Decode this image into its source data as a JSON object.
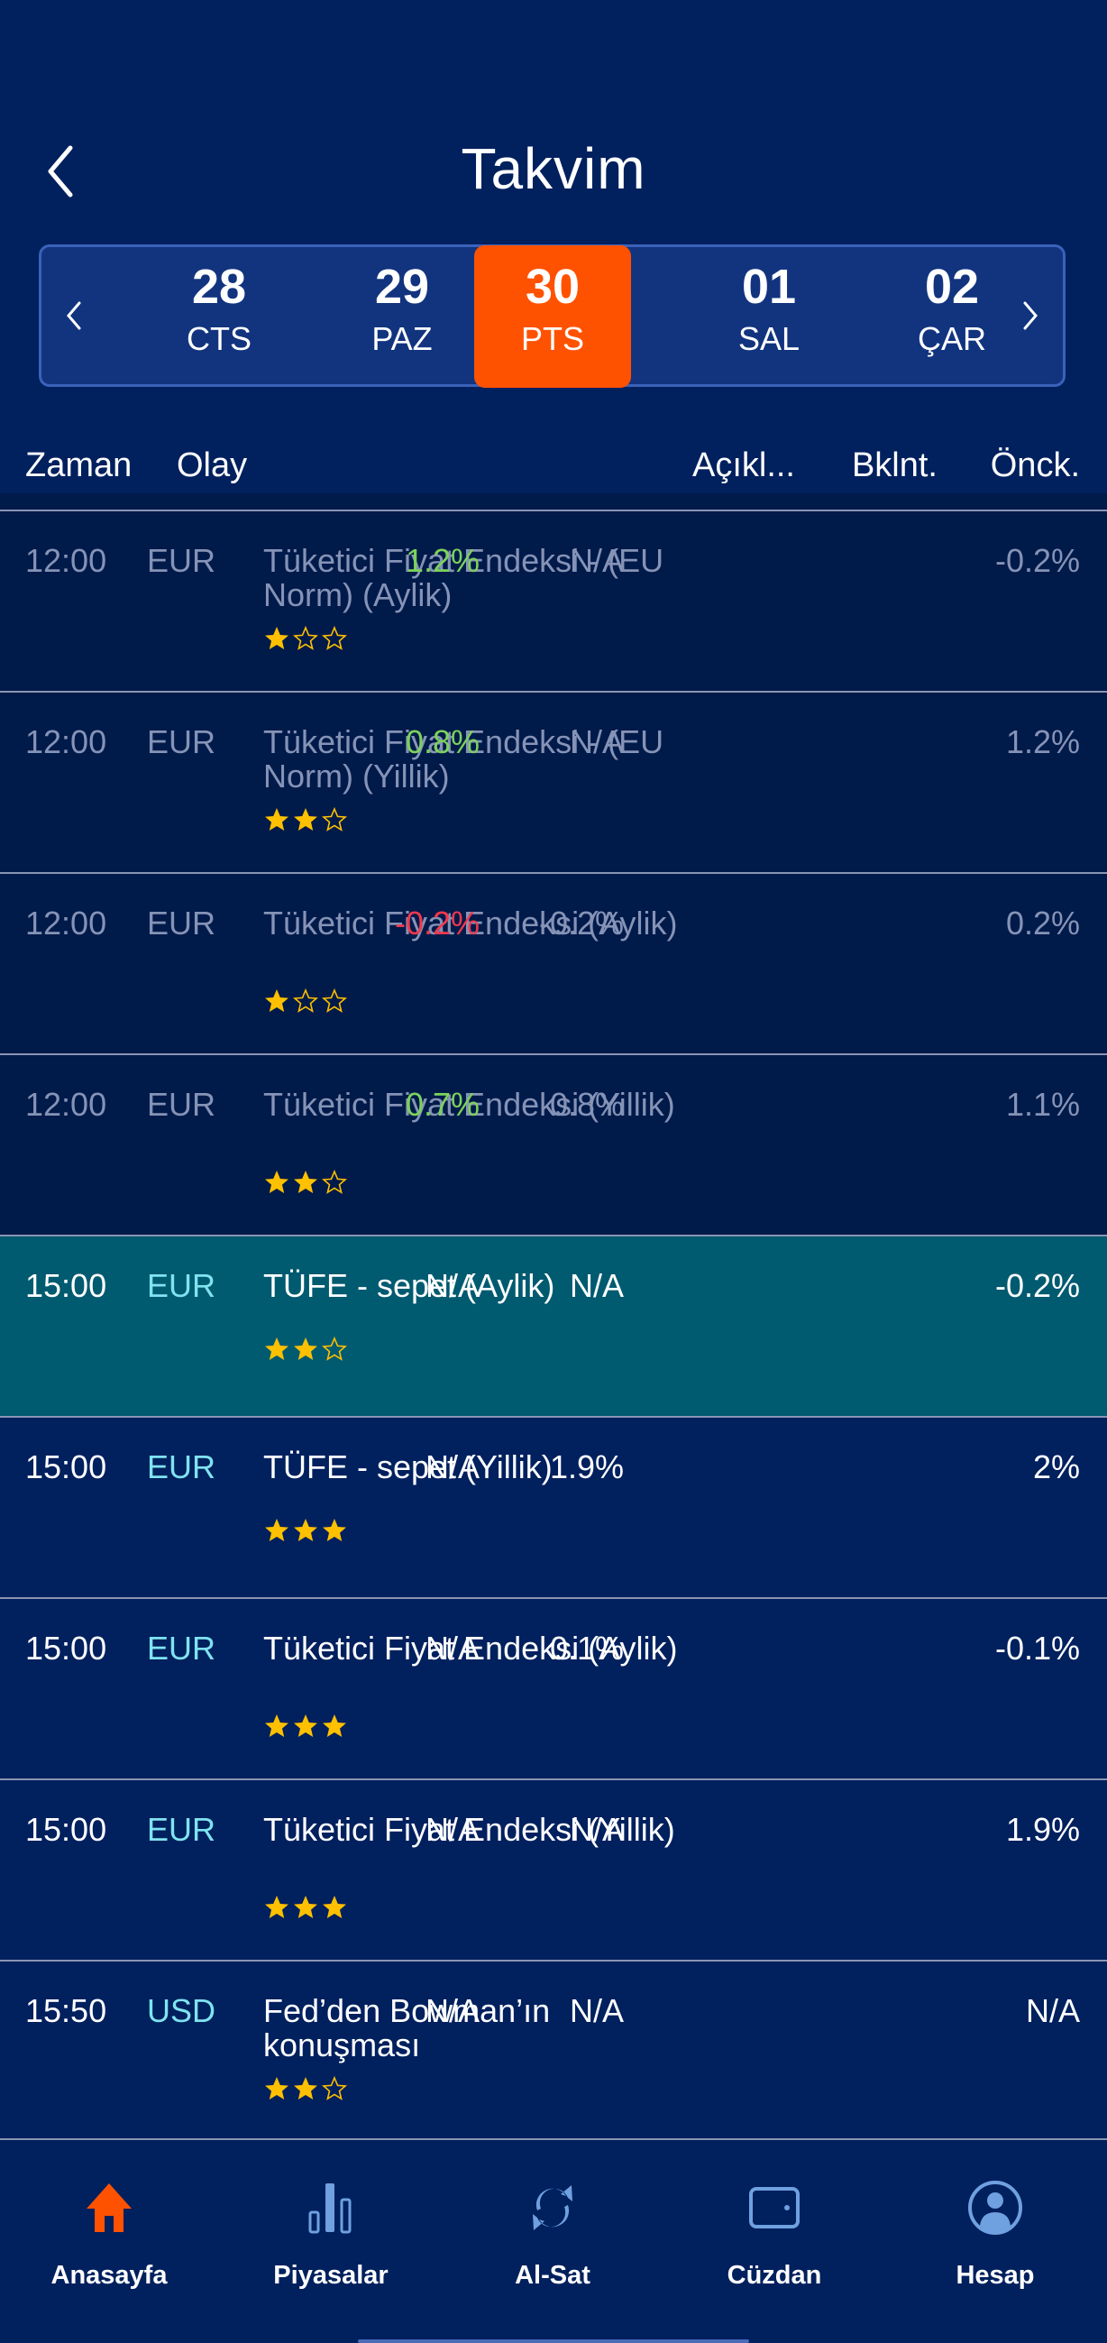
{
  "header": {
    "title": "Takvim",
    "back_icon": "chevron-left-icon"
  },
  "date_selector": {
    "prev_icon": "chevron-left-icon",
    "next_icon": "chevron-right-icon",
    "selected_index": 2,
    "days": [
      {
        "num": "28",
        "dow": "CTS"
      },
      {
        "num": "29",
        "dow": "PAZ"
      },
      {
        "num": "30",
        "dow": "PTS"
      },
      {
        "num": "01",
        "dow": "SAL"
      },
      {
        "num": "02",
        "dow": "ÇAR"
      }
    ]
  },
  "columns": {
    "time": "Zaman",
    "event": "Olay",
    "actual": "Açıkl...",
    "expected": "Bklnt.",
    "previous": "Önck."
  },
  "colors": {
    "accent": "#ff5200",
    "background": "#00205e",
    "past_row": "#001a4a",
    "current_row": "#005a70",
    "positive": "#7cd25c",
    "negative": "#f0384e",
    "star": "#ffc000"
  },
  "events": [
    {
      "time": "12:00",
      "currency": "EUR",
      "name": "Tüketici Fiyat Endeksi - (EU Norm) (Aylik)",
      "stars": 1,
      "actual": "1.2%",
      "actual_trend": "pos",
      "expected": "N/A",
      "previous": "-0.2%",
      "state": "past"
    },
    {
      "time": "12:00",
      "currency": "EUR",
      "name": "Tüketici Fiyat Endeksi - (EU Norm) (Yillik)",
      "stars": 2,
      "actual": "0.8%",
      "actual_trend": "pos",
      "expected": "N/A",
      "previous": "1.2%",
      "state": "past"
    },
    {
      "time": "12:00",
      "currency": "EUR",
      "name": "Tüketici Fiyat Endeksi (Aylik)",
      "stars": 1,
      "actual": "-0.2%",
      "actual_trend": "neg",
      "expected": "-0.2%",
      "previous": "0.2%",
      "state": "past"
    },
    {
      "time": "12:00",
      "currency": "EUR",
      "name": "Tüketici Fiyat Endeksi (Yillik)",
      "stars": 2,
      "actual": "0.7%",
      "actual_trend": "pos",
      "expected": "0.8%",
      "previous": "1.1%",
      "state": "past"
    },
    {
      "time": "15:00",
      "currency": "EUR",
      "name": "TÜFE  - sepet (Aylik)",
      "stars": 2,
      "actual": "N/A",
      "actual_trend": "none",
      "expected": "N/A",
      "previous": "-0.2%",
      "state": "cur"
    },
    {
      "time": "15:00",
      "currency": "EUR",
      "name": "TÜFE  - sepet (Yillik)",
      "stars": 3,
      "actual": "N/A",
      "actual_trend": "none",
      "expected": "1.9%",
      "previous": "2%",
      "state": "fut"
    },
    {
      "time": "15:00",
      "currency": "EUR",
      "name": "Tüketici Fiyat Endeksi (Aylik)",
      "stars": 3,
      "actual": "N/A",
      "actual_trend": "none",
      "expected": "0.1%",
      "previous": "-0.1%",
      "state": "fut"
    },
    {
      "time": "15:00",
      "currency": "EUR",
      "name": "Tüketici Fiyat Endeksi (Yillik)",
      "stars": 3,
      "actual": "N/A",
      "actual_trend": "none",
      "expected": "N/A",
      "previous": "1.9%",
      "state": "fut"
    },
    {
      "time": "15:50",
      "currency": "USD",
      "name": "Fed’den Bowman’ın konuşması",
      "stars": 2,
      "actual": "N/A",
      "actual_trend": "none",
      "expected": "N/A",
      "previous": "N/A",
      "state": "fut"
    }
  ],
  "bottom_nav": {
    "active_index": 0,
    "items": [
      {
        "label": "Anasayfa",
        "icon": "home-icon"
      },
      {
        "label": "Piyasalar",
        "icon": "bar-chart-icon"
      },
      {
        "label": "Al-Sat",
        "icon": "refresh-icon"
      },
      {
        "label": "Cüzdan",
        "icon": "wallet-icon"
      },
      {
        "label": "Hesap",
        "icon": "account-icon"
      }
    ]
  }
}
